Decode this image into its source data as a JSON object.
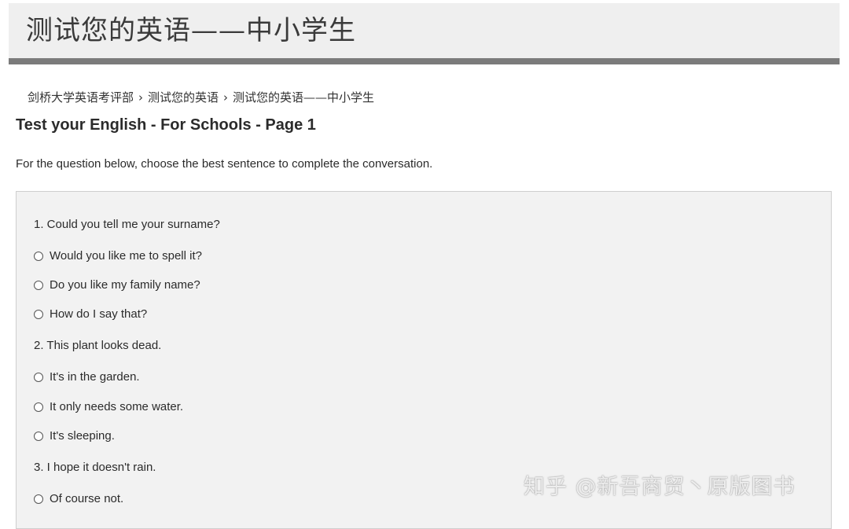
{
  "banner": {
    "title": "测试您的英语——中小学生"
  },
  "breadcrumb": {
    "items": [
      "剑桥大学英语考评部",
      "测试您的英语",
      "测试您的英语——中小学生"
    ],
    "separator": "›"
  },
  "page": {
    "heading": "Test your English - For Schools - Page 1",
    "instructions": "For the question below, choose the best sentence to complete the conversation."
  },
  "questions": [
    {
      "prompt": "1. Could you tell me your surname?",
      "options": [
        "Would you like me to spell it?",
        "Do you like my family name?",
        "How do I say that?"
      ]
    },
    {
      "prompt": "2. This plant looks dead.",
      "options": [
        "It's in the garden.",
        "It only needs some water.",
        "It's sleeping."
      ]
    },
    {
      "prompt": "3. I hope it doesn't rain.",
      "options": [
        "Of course not."
      ]
    }
  ],
  "watermark": {
    "text": "知乎 @新吾商贸丶原版图书"
  },
  "colors": {
    "banner_bg": "#efefef",
    "banner_rule": "#7b7b7b",
    "panel_bg": "#f2f2f2",
    "panel_border": "#cfcfcf",
    "text": "#2b2b2b"
  }
}
